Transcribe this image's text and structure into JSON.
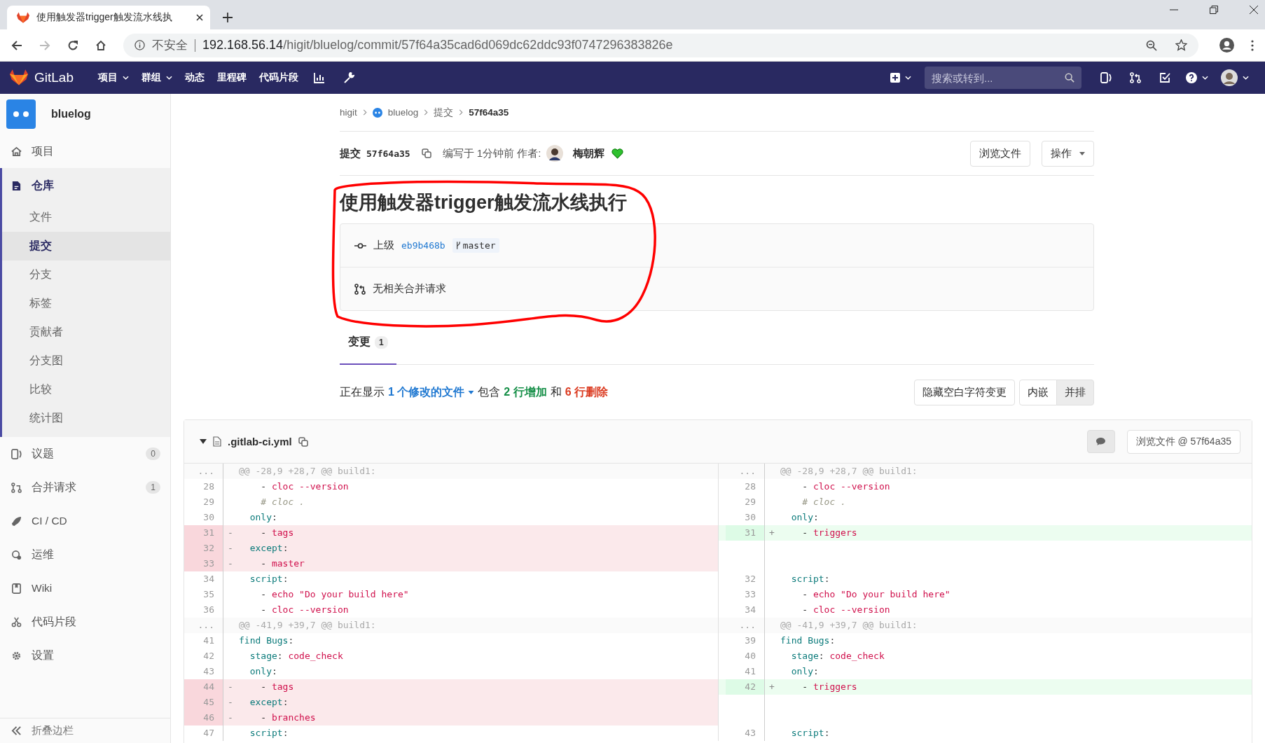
{
  "browser": {
    "tab_title": "使用触发器trigger触发流水线执",
    "security_label": "不安全",
    "url_host": "192.168.56.14",
    "url_path": "/higit/bluelog/commit/57f64a35cad6d069dc62ddc93f0747296383826e"
  },
  "navbar": {
    "brand": "GitLab",
    "menu": [
      {
        "label": "项目",
        "dropdown": true
      },
      {
        "label": "群组",
        "dropdown": true
      },
      {
        "label": "动态",
        "dropdown": false
      },
      {
        "label": "里程碑",
        "dropdown": false
      },
      {
        "label": "代码片段",
        "dropdown": false
      }
    ],
    "search": {
      "placeholder": "搜索或转到..."
    }
  },
  "sidebar": {
    "project": "bluelog",
    "items": [
      {
        "label": "项目",
        "selected": false
      },
      {
        "label": "仓库",
        "selected": true,
        "children": [
          {
            "label": "文件",
            "selected": false
          },
          {
            "label": "提交",
            "selected": true
          },
          {
            "label": "分支",
            "selected": false
          },
          {
            "label": "标签",
            "selected": false
          },
          {
            "label": "贡献者",
            "selected": false
          },
          {
            "label": "分支图",
            "selected": false
          },
          {
            "label": "比较",
            "selected": false
          },
          {
            "label": "统计图",
            "selected": false
          }
        ]
      },
      {
        "label": "议题",
        "selected": false,
        "badge": "0"
      },
      {
        "label": "合并请求",
        "selected": false,
        "badge": "1"
      },
      {
        "label": "CI / CD",
        "selected": false
      },
      {
        "label": "运维",
        "selected": false
      },
      {
        "label": "Wiki",
        "selected": false
      },
      {
        "label": "代码片段",
        "selected": false
      },
      {
        "label": "设置",
        "selected": false
      }
    ],
    "collapse": "折叠边栏"
  },
  "breadcrumb": [
    {
      "label": "higit"
    },
    {
      "label": "bluelog"
    },
    {
      "label": "提交"
    },
    {
      "label": "57f64a35"
    }
  ],
  "commit": {
    "label": "提交",
    "sha": "57f64a35",
    "authored": "编写于 1分钟前 作者:",
    "author": "梅朝辉",
    "buttons": [
      {
        "label": "浏览文件",
        "dropdown": false
      },
      {
        "label": "操作",
        "dropdown": true
      }
    ],
    "title": "使用触发器trigger触发流水线执行",
    "parent_label": "上级",
    "parent_sha": "eb9b468b",
    "branch": "master",
    "merge_requests": "无相关合并请求"
  },
  "tabs": [
    {
      "label": "变更",
      "count": "1",
      "selected": true
    }
  ],
  "summary": [
    {
      "kind": "plain",
      "text": "正在显示"
    },
    {
      "kind": "link",
      "text": "1 个修改的文件"
    },
    {
      "kind": "plain",
      "text": "包含"
    },
    {
      "kind": "added",
      "text": "2 行增加"
    },
    {
      "kind": "plain",
      "text": "和"
    },
    {
      "kind": "removed",
      "text": "6 行删除"
    }
  ],
  "view_buttons": [
    {
      "label": "隐藏空白字符变更",
      "selected": false
    },
    {
      "label": "内嵌",
      "selected": false
    },
    {
      "label": "并排",
      "selected": true
    }
  ],
  "file": {
    "name": ".gitlab-ci.yml",
    "expanded": true,
    "view_button": "浏览文件 @ 57f64a35",
    "rows": [
      {
        "left": {
          "num": "...",
          "kind": "hunk",
          "code": [
            {
              "kind": "meta",
              "text": "@@ -28,9 +28,7 @@ build1:"
            }
          ]
        },
        "right": {
          "num": "...",
          "kind": "hunk",
          "code": [
            {
              "kind": "meta",
              "text": "@@ -28,9 +28,7 @@ build1:"
            }
          ]
        }
      },
      {
        "left": {
          "num": "28",
          "kind": "context",
          "code": [
            {
              "kind": "plain",
              "text": "    - "
            },
            {
              "kind": "str",
              "text": "cloc --version"
            }
          ]
        },
        "right": {
          "num": "28",
          "kind": "context",
          "code": [
            {
              "kind": "plain",
              "text": "    - "
            },
            {
              "kind": "str",
              "text": "cloc --version"
            }
          ]
        }
      },
      {
        "left": {
          "num": "29",
          "kind": "context",
          "code": [
            {
              "kind": "comment",
              "text": "    # cloc ."
            }
          ]
        },
        "right": {
          "num": "29",
          "kind": "context",
          "code": [
            {
              "kind": "comment",
              "text": "    # cloc ."
            }
          ]
        }
      },
      {
        "left": {
          "num": "30",
          "kind": "context",
          "code": [
            {
              "kind": "key",
              "text": "  only"
            },
            {
              "kind": "plain",
              "text": ":"
            }
          ]
        },
        "right": {
          "num": "30",
          "kind": "context",
          "code": [
            {
              "kind": "key",
              "text": "  only"
            },
            {
              "kind": "plain",
              "text": ":"
            }
          ]
        }
      },
      {
        "left": {
          "num": "31",
          "kind": "old",
          "sign": "-",
          "code": [
            {
              "kind": "plain",
              "text": "    - "
            },
            {
              "kind": "str",
              "text": "tags"
            }
          ]
        },
        "right": {
          "num": "31",
          "kind": "new",
          "sign": "+",
          "code": [
            {
              "kind": "plain",
              "text": "    - "
            },
            {
              "kind": "str",
              "text": "triggers"
            }
          ]
        }
      },
      {
        "left": {
          "num": "32",
          "kind": "old",
          "sign": "-",
          "code": [
            {
              "kind": "key",
              "text": "  except"
            },
            {
              "kind": "plain",
              "text": ":"
            }
          ]
        },
        "right": {
          "kind": "empty"
        }
      },
      {
        "left": {
          "num": "33",
          "kind": "old",
          "sign": "-",
          "code": [
            {
              "kind": "plain",
              "text": "    - "
            },
            {
              "kind": "str",
              "text": "master"
            }
          ]
        },
        "right": {
          "kind": "empty"
        }
      },
      {
        "left": {
          "num": "34",
          "kind": "context",
          "code": [
            {
              "kind": "key",
              "text": "  script"
            },
            {
              "kind": "plain",
              "text": ":"
            }
          ]
        },
        "right": {
          "num": "32",
          "kind": "context",
          "code": [
            {
              "kind": "key",
              "text": "  script"
            },
            {
              "kind": "plain",
              "text": ":"
            }
          ]
        }
      },
      {
        "left": {
          "num": "35",
          "kind": "context",
          "code": [
            {
              "kind": "plain",
              "text": "    - "
            },
            {
              "kind": "str",
              "text": "echo \"Do your build here\""
            }
          ]
        },
        "right": {
          "num": "33",
          "kind": "context",
          "code": [
            {
              "kind": "plain",
              "text": "    - "
            },
            {
              "kind": "str",
              "text": "echo \"Do your build here\""
            }
          ]
        }
      },
      {
        "left": {
          "num": "36",
          "kind": "context",
          "code": [
            {
              "kind": "plain",
              "text": "    - "
            },
            {
              "kind": "str",
              "text": "cloc --version"
            }
          ]
        },
        "right": {
          "num": "34",
          "kind": "context",
          "code": [
            {
              "kind": "plain",
              "text": "    - "
            },
            {
              "kind": "str",
              "text": "cloc --version"
            }
          ]
        }
      },
      {
        "left": {
          "num": "...",
          "kind": "hunk",
          "code": [
            {
              "kind": "meta",
              "text": "@@ -41,9 +39,7 @@ build1:"
            }
          ]
        },
        "right": {
          "num": "...",
          "kind": "hunk",
          "code": [
            {
              "kind": "meta",
              "text": "@@ -41,9 +39,7 @@ build1:"
            }
          ]
        }
      },
      {
        "left": {
          "num": "41",
          "kind": "context",
          "code": [
            {
              "kind": "key",
              "text": "find Bugs"
            },
            {
              "kind": "plain",
              "text": ":"
            }
          ]
        },
        "right": {
          "num": "39",
          "kind": "context",
          "code": [
            {
              "kind": "key",
              "text": "find Bugs"
            },
            {
              "kind": "plain",
              "text": ":"
            }
          ]
        }
      },
      {
        "left": {
          "num": "42",
          "kind": "context",
          "code": [
            {
              "kind": "key",
              "text": "  stage"
            },
            {
              "kind": "plain",
              "text": ": "
            },
            {
              "kind": "str",
              "text": "code_check"
            }
          ]
        },
        "right": {
          "num": "40",
          "kind": "context",
          "code": [
            {
              "kind": "key",
              "text": "  stage"
            },
            {
              "kind": "plain",
              "text": ": "
            },
            {
              "kind": "str",
              "text": "code_check"
            }
          ]
        }
      },
      {
        "left": {
          "num": "43",
          "kind": "context",
          "code": [
            {
              "kind": "key",
              "text": "  only"
            },
            {
              "kind": "plain",
              "text": ":"
            }
          ]
        },
        "right": {
          "num": "41",
          "kind": "context",
          "code": [
            {
              "kind": "key",
              "text": "  only"
            },
            {
              "kind": "plain",
              "text": ":"
            }
          ]
        }
      },
      {
        "left": {
          "num": "44",
          "kind": "old",
          "sign": "-",
          "code": [
            {
              "kind": "plain",
              "text": "    - "
            },
            {
              "kind": "str",
              "text": "tags"
            }
          ]
        },
        "right": {
          "num": "42",
          "kind": "new",
          "sign": "+",
          "code": [
            {
              "kind": "plain",
              "text": "    - "
            },
            {
              "kind": "str",
              "text": "triggers"
            }
          ]
        }
      },
      {
        "left": {
          "num": "45",
          "kind": "old",
          "sign": "-",
          "code": [
            {
              "kind": "key",
              "text": "  except"
            },
            {
              "kind": "plain",
              "text": ":"
            }
          ]
        },
        "right": {
          "kind": "empty"
        }
      },
      {
        "left": {
          "num": "46",
          "kind": "old",
          "sign": "-",
          "code": [
            {
              "kind": "plain",
              "text": "    - "
            },
            {
              "kind": "str",
              "text": "branches"
            }
          ]
        },
        "right": {
          "kind": "empty"
        }
      },
      {
        "left": {
          "num": "47",
          "kind": "context",
          "code": [
            {
              "kind": "key",
              "text": "  script"
            },
            {
              "kind": "plain",
              "text": ":"
            }
          ]
        },
        "right": {
          "num": "43",
          "kind": "context",
          "code": [
            {
              "kind": "key",
              "text": "  script"
            },
            {
              "kind": "plain",
              "text": ":"
            }
          ]
        }
      }
    ]
  }
}
